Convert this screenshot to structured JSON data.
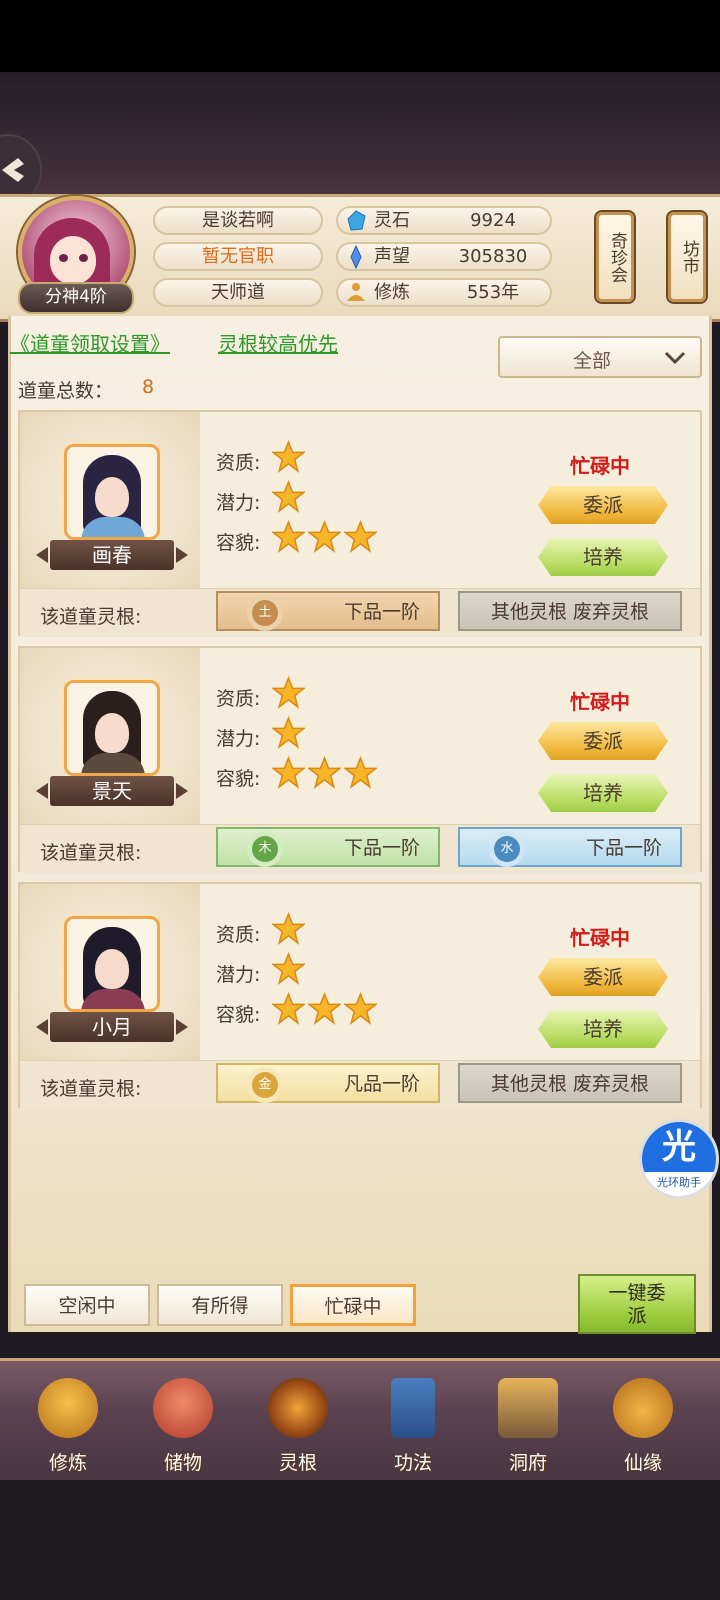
{
  "header": {
    "rank": "分神4阶",
    "name": "是谈若啊",
    "title": "暂无官职",
    "sect": "天师道",
    "resources": [
      {
        "icon": "spirit-stone-icon",
        "label": "灵石",
        "value": "9924"
      },
      {
        "icon": "prestige-crystal-icon",
        "label": "声望",
        "value": "305830"
      },
      {
        "icon": "meditation-icon",
        "label": "修炼",
        "value": "553年"
      }
    ],
    "side_buttons": [
      "奇珍会",
      "坊市"
    ]
  },
  "settings": {
    "link": "《道童领取设置》",
    "priority": "灵根较高优先",
    "filter_selected": "全部",
    "count_label": "道童总数：",
    "count_value": "8"
  },
  "labels": {
    "aptitude": "资质:",
    "potential": "潜力:",
    "appearance": "容貌:",
    "root": "该道童灵根:",
    "dispatch": "委派",
    "train": "培养"
  },
  "apprentices": [
    {
      "name": "画春",
      "status": "忙碌中",
      "aptitude": 1,
      "potential": 1,
      "appearance": 3,
      "roots": [
        {
          "element": "土",
          "grade": "下品一阶",
          "style": "earth"
        },
        {
          "text": "其他灵根 废弃灵根",
          "style": "other"
        }
      ]
    },
    {
      "name": "景天",
      "status": "忙碌中",
      "aptitude": 1,
      "potential": 1,
      "appearance": 3,
      "roots": [
        {
          "element": "木",
          "grade": "下品一阶",
          "style": "wood"
        },
        {
          "element": "水",
          "grade": "下品一阶",
          "style": "water"
        }
      ]
    },
    {
      "name": "小月",
      "status": "忙碌中",
      "aptitude": 1,
      "potential": 1,
      "appearance": 3,
      "roots": [
        {
          "element": "金",
          "grade": "凡品一阶",
          "style": "metal"
        },
        {
          "text": "其他灵根 废弃灵根",
          "style": "other"
        }
      ]
    }
  ],
  "assistant": {
    "glyph": "光",
    "label": "光环助手"
  },
  "tabs": [
    "空闲中",
    "有所得",
    "忙碌中"
  ],
  "active_tab": "忙碌中",
  "one_key": "一键委派",
  "nav": [
    "修炼",
    "储物",
    "灵根",
    "功法",
    "洞府",
    "仙缘"
  ],
  "colors": {
    "busy": "#d41a1a",
    "link": "#2c9a2a",
    "accent": "#f0a23c"
  }
}
